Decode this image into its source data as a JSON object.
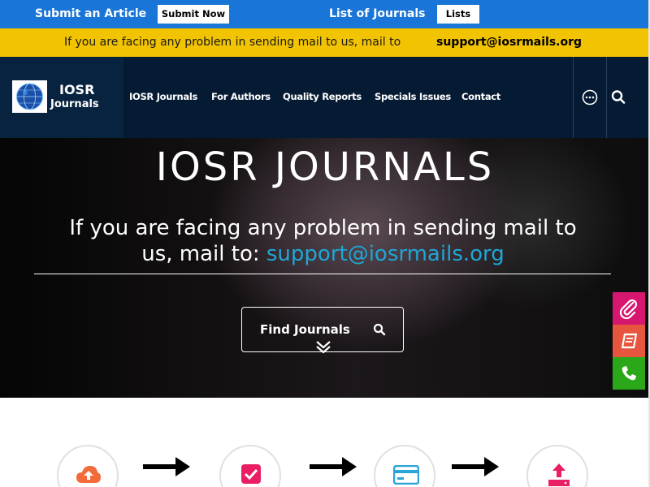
{
  "topbar": {
    "submit_label": "Submit an Article",
    "submit_button": "Submit Now",
    "journals_label": "List of Journals",
    "lists_button": "Lists",
    "bg_color": "#1a75d8"
  },
  "notice": {
    "text": "If you are facing any problem in sending mail to us, mail to",
    "email": "support@iosrmails.org",
    "bg_color": "#f2c300"
  },
  "navbar": {
    "logo_line1": "IOSR",
    "logo_line2": "Journals",
    "items": [
      {
        "label": "IOSR Journals"
      },
      {
        "label": "For Authors"
      },
      {
        "label": "Quality Reports"
      },
      {
        "label": "Specials Issues"
      },
      {
        "label": "Contact"
      }
    ],
    "icons": [
      "more-icon",
      "search-icon"
    ]
  },
  "hero": {
    "title": "IOSR JOURNALS",
    "line1": "If you are facing any problem in sending mail to",
    "line2_prefix": "us, mail to: ",
    "line2_email": "support@iosrmails.org",
    "find_button": "Find Journals",
    "accent_color": "#1ea7d6"
  },
  "side_buttons": [
    {
      "icon": "paperclip-icon",
      "color": "#d6166f"
    },
    {
      "icon": "book-icon",
      "color": "#e8553f"
    },
    {
      "icon": "phone-icon",
      "color": "#2aa81a"
    }
  ],
  "steps": [
    {
      "icon": "cloud-upload-icon",
      "color": "#f26b3a"
    },
    {
      "icon": "checkbox-icon",
      "color": "#e91e63"
    },
    {
      "icon": "credit-card-icon",
      "color": "#2aa5d8"
    },
    {
      "icon": "upload-tray-icon",
      "color": "#e91e63"
    }
  ]
}
